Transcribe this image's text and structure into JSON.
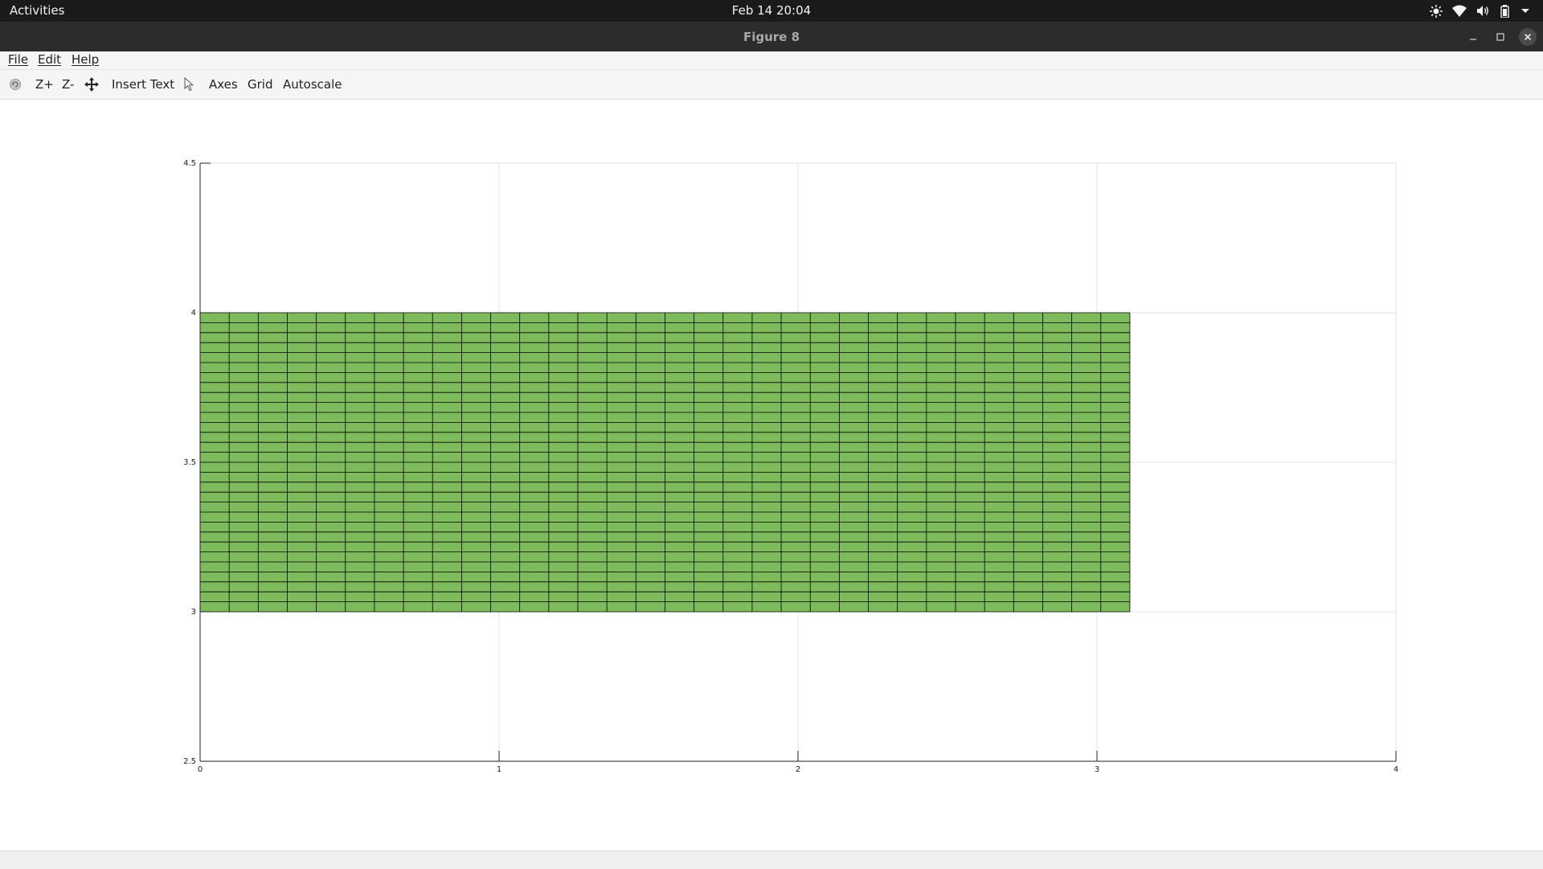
{
  "system_bar": {
    "activities_label": "Activities",
    "clock": "Feb 14  20:04",
    "tray_icons": [
      "brightness-icon",
      "wifi-icon",
      "volume-icon",
      "battery-icon",
      "chevron-down-icon"
    ]
  },
  "window": {
    "title": "Figure 8",
    "controls": [
      "minimize-icon",
      "maximize-icon",
      "close-icon"
    ]
  },
  "menu": {
    "file": "File",
    "edit": "Edit",
    "help": "Help"
  },
  "toolbar": {
    "rotate_icon": "rotate-icon",
    "zoom_in": "Z+",
    "zoom_out": "Z-",
    "pan_icon": "pan-icon",
    "insert_text": "Insert Text",
    "select_icon": "pointer-icon",
    "axes": "Axes",
    "grid": "Grid",
    "autoscale": "Autoscale"
  },
  "colors": {
    "patch_fill": "#7ebb5c",
    "patch_edge": "#000000",
    "grid": "#e3e3e3"
  },
  "chart_data": {
    "type": "patch-mesh",
    "title": "",
    "xlabel": "",
    "ylabel": "",
    "xlim": [
      0,
      4
    ],
    "ylim": [
      2.5,
      4.5
    ],
    "xticks": [
      "0",
      "1",
      "2",
      "3",
      "4"
    ],
    "yticks": [
      "2.5",
      "3",
      "3.5",
      "4",
      "4.5"
    ],
    "grid": true,
    "mesh": {
      "x_range": [
        0,
        3.11
      ],
      "y_range": [
        3.0,
        4.0
      ],
      "columns": 32,
      "rows": 30,
      "fill": "#7ebb5c",
      "edge": "#000000"
    }
  }
}
